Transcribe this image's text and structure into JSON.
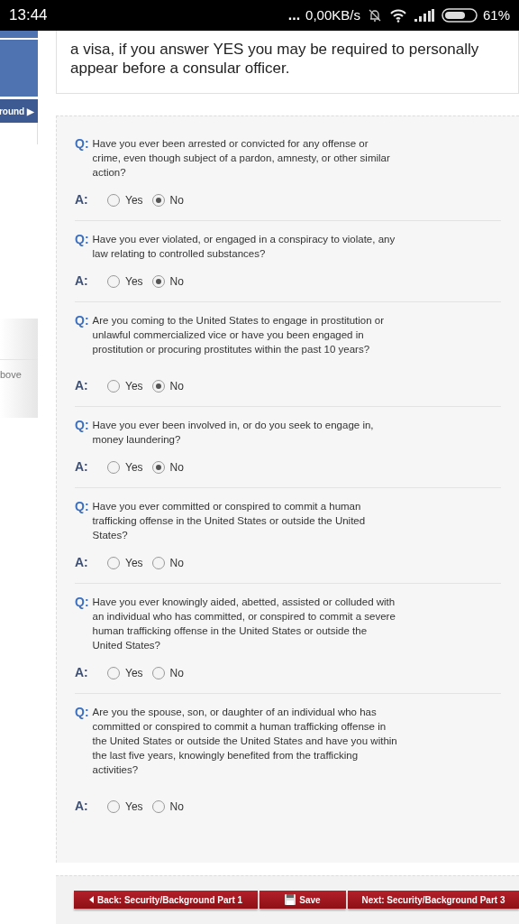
{
  "status_bar": {
    "time": "13:44",
    "dots": "...",
    "speed": "0,00KB/s",
    "battery": "61%"
  },
  "sidebar": {
    "nav_item": "round ▶",
    "panel_text": "bove"
  },
  "intro": "a visa, if you answer YES you may be required to personally appear before a consular officer.",
  "questions": [
    {
      "q_label": "Q:",
      "text": "Have you ever been arrested or convicted for any offense or crime, even though subject of a pardon, amnesty, or other similar action?",
      "a_label": "A:",
      "options": [
        {
          "label": "Yes",
          "selected": false
        },
        {
          "label": "No",
          "selected": true
        }
      ]
    },
    {
      "q_label": "Q:",
      "text": "Have you ever violated, or engaged in a conspiracy to violate, any law relating to controlled substances?",
      "a_label": "A:",
      "options": [
        {
          "label": "Yes",
          "selected": false
        },
        {
          "label": "No",
          "selected": true
        }
      ]
    },
    {
      "q_label": "Q:",
      "text": "Are you coming to the United States to engage in prostitution or unlawful commercialized vice or have you been engaged in prostitution or procuring prostitutes within the past 10 years?",
      "a_label": "A:",
      "options": [
        {
          "label": "Yes",
          "selected": false
        },
        {
          "label": "No",
          "selected": true
        }
      ]
    },
    {
      "q_label": "Q:",
      "text": "Have you ever been involved in, or do you seek to engage in, money laundering?",
      "a_label": "A:",
      "options": [
        {
          "label": "Yes",
          "selected": false
        },
        {
          "label": "No",
          "selected": true
        }
      ]
    },
    {
      "q_label": "Q:",
      "text": "Have you ever committed or conspired to commit a human trafficking offense in the United States or outside the United States?",
      "a_label": "A:",
      "options": [
        {
          "label": "Yes",
          "selected": false
        },
        {
          "label": "No",
          "selected": false
        }
      ]
    },
    {
      "q_label": "Q:",
      "text": "Have you ever knowingly aided, abetted, assisted or colluded with an individual who has committed, or conspired to commit a severe human trafficking offense in the United States or outside the United States?",
      "a_label": "A:",
      "options": [
        {
          "label": "Yes",
          "selected": false
        },
        {
          "label": "No",
          "selected": false
        }
      ]
    },
    {
      "q_label": "Q:",
      "text": "Are you the spouse, son, or daughter of an individual who has committed or conspired to commit a human trafficking offense in the United States or outside the United States and have you within the last five years, knowingly benefited from the trafficking activities?",
      "a_label": "A:",
      "options": [
        {
          "label": "Yes",
          "selected": false
        },
        {
          "label": "No",
          "selected": false
        }
      ]
    }
  ],
  "buttons": [
    {
      "kind": "back",
      "label": "Back: Security/Background Part 1"
    },
    {
      "kind": "save",
      "label": "Save"
    },
    {
      "kind": "next",
      "label": "Next: Security/Background Part 3"
    }
  ]
}
